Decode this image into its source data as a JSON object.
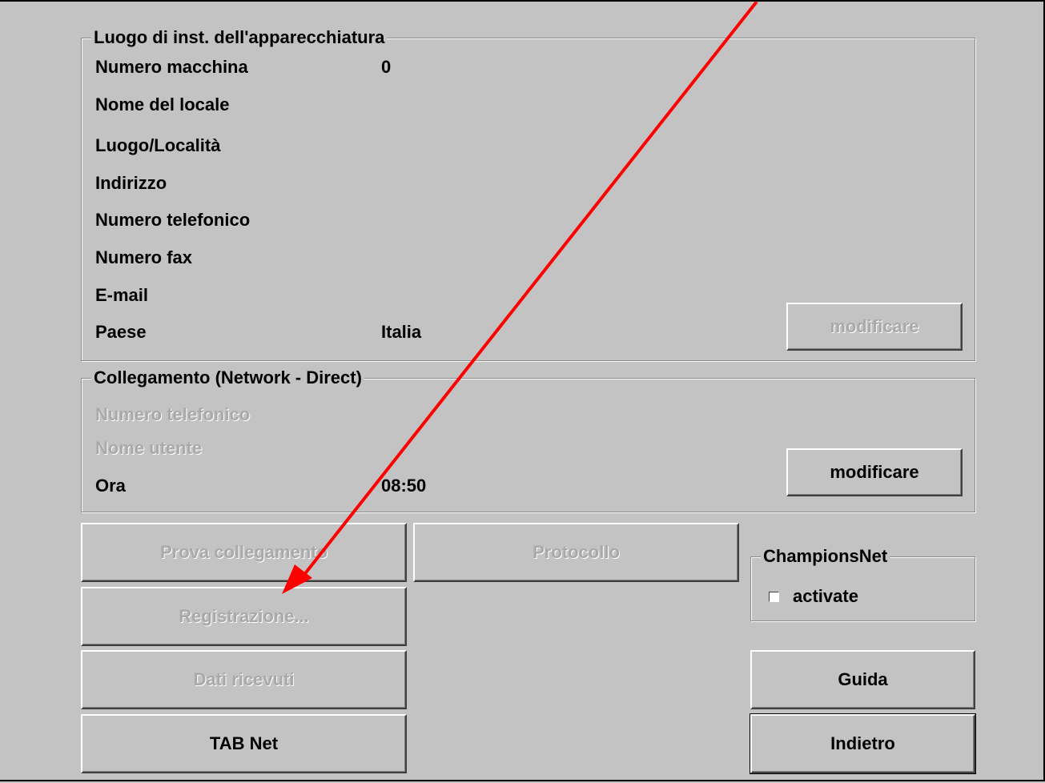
{
  "location_group": {
    "title": "Luogo di inst. dell'apparecchiatura",
    "fields": [
      {
        "label": "Numero macchina",
        "value": "0"
      },
      {
        "label": "Nome del locale",
        "value": ""
      },
      {
        "label": "Luogo/Località",
        "value": ""
      },
      {
        "label": "Indirizzo",
        "value": ""
      },
      {
        "label": "Numero telefonico",
        "value": ""
      },
      {
        "label": "Numero fax",
        "value": ""
      },
      {
        "label": "E-mail",
        "value": ""
      },
      {
        "label": "Paese",
        "value": "Italia"
      }
    ],
    "edit_button": "modificare"
  },
  "connection_group": {
    "title": "Collegamento (Network - Direct)",
    "phone_label": "Numero telefonico",
    "user_label": "Nome utente",
    "time_label": "Ora",
    "time_value": "08:50",
    "edit_button": "modificare"
  },
  "buttons": {
    "test_connection": "Prova collegamento",
    "protocol": "Protocollo",
    "registration": "Registrazione...",
    "received_data": "Dati ricevuti",
    "tab_net": "TAB Net",
    "help": "Guida",
    "back": "Indietro"
  },
  "champions_group": {
    "title": "ChampionsNet",
    "checkbox_label": "activate",
    "checked": false
  },
  "annotation": {
    "color": "#ff0000",
    "icon": "red-arrow"
  }
}
